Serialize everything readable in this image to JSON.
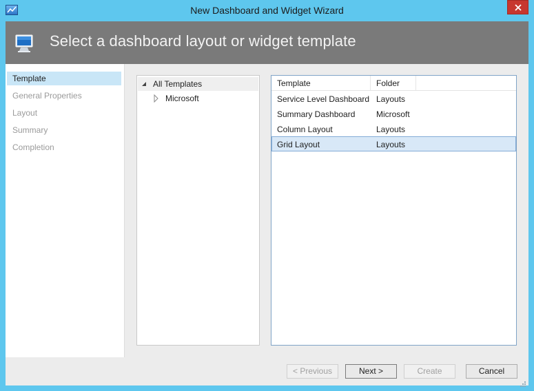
{
  "window": {
    "title": "New Dashboard and Widget Wizard"
  },
  "header": {
    "title": "Select a dashboard layout or widget template"
  },
  "steps": [
    {
      "label": "Template",
      "active": true
    },
    {
      "label": "General Properties",
      "active": false
    },
    {
      "label": "Layout",
      "active": false
    },
    {
      "label": "Summary",
      "active": false
    },
    {
      "label": "Completion",
      "active": false
    }
  ],
  "tree": {
    "root": "All Templates",
    "children": [
      "Microsoft"
    ]
  },
  "list": {
    "columns": [
      "Template",
      "Folder"
    ],
    "rows": [
      {
        "template": "Service Level Dashboard",
        "folder": "Layouts"
      },
      {
        "template": "Summary Dashboard",
        "folder": "Microsoft"
      },
      {
        "template": "Column Layout",
        "folder": "Layouts"
      },
      {
        "template": "Grid Layout",
        "folder": "Layouts"
      }
    ],
    "selected_index": 3
  },
  "buttons": {
    "previous": "< Previous",
    "next": "Next >",
    "create": "Create",
    "cancel": "Cancel"
  },
  "colors": {
    "window_frame": "#5ec7ee",
    "header_band": "#7a7a7a",
    "close_button": "#c7372f",
    "active_step": "#c9e6f7",
    "selected_row": "#d8e8f7"
  }
}
